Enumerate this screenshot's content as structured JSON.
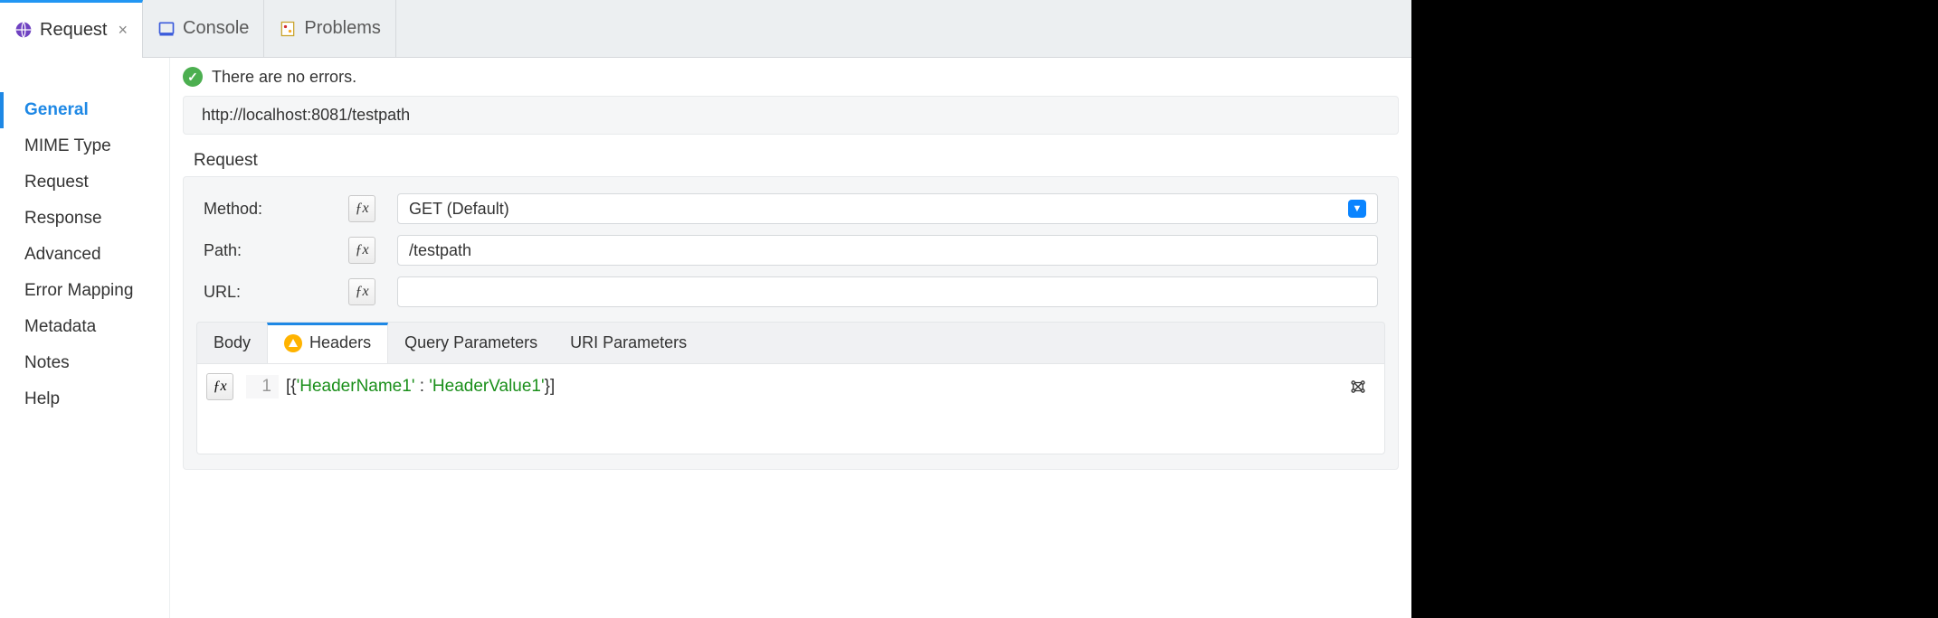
{
  "tabs": {
    "request": "Request",
    "console": "Console",
    "problems": "Problems"
  },
  "sidebar": {
    "items": [
      "General",
      "MIME Type",
      "Request",
      "Response",
      "Advanced",
      "Error Mapping",
      "Metadata",
      "Notes",
      "Help"
    ]
  },
  "status": {
    "message": "There are no errors."
  },
  "url_bar": {
    "value": "http://localhost:8081/testpath"
  },
  "section": {
    "request_label": "Request"
  },
  "form": {
    "method_label": "Method:",
    "method_value": "GET (Default)",
    "path_label": "Path:",
    "path_value": "/testpath",
    "url_label": "URL:",
    "url_value": ""
  },
  "subtabs": {
    "body": "Body",
    "headers": "Headers",
    "query_params": "Query Parameters",
    "uri_params": "URI Parameters"
  },
  "code": {
    "line_no": "1",
    "tokens": {
      "open": "[{",
      "key": "'HeaderName1'",
      "colon": " : ",
      "val": "'HeaderValue1'",
      "close": "}]"
    }
  }
}
